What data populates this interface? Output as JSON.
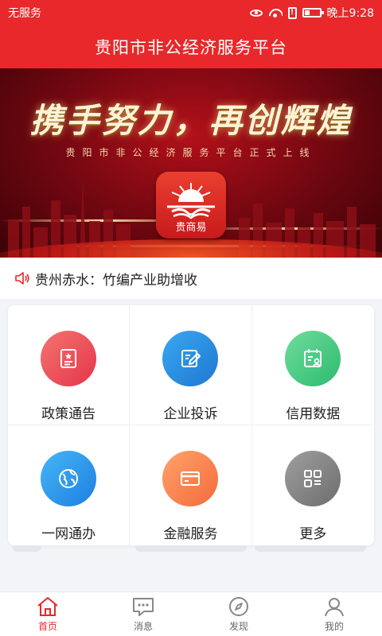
{
  "status_bar": {
    "carrier": "无服务",
    "time": "晚上9:28",
    "icons": [
      "eye-icon",
      "wifi-icon",
      "sim-icon",
      "battery-icon"
    ]
  },
  "header": {
    "title": "贵阳市非公经济服务平台"
  },
  "banner": {
    "headline": "携手努力，再创辉煌",
    "subtitle": "贵阳市非公经济服务平台正式上线",
    "logo_caption": "贵商易"
  },
  "ticker": {
    "icon": "speaker-icon",
    "text": "贵州赤水：竹编产业助增收"
  },
  "services": [
    {
      "label": "政策通告",
      "icon": "policy-document-icon",
      "color_from": "#f3756f",
      "color_to": "#e4344a"
    },
    {
      "label": "企业投诉",
      "icon": "edit-form-icon",
      "color_from": "#3aa7f0",
      "color_to": "#1f78d1"
    },
    {
      "label": "信用数据",
      "icon": "credit-calendar-icon",
      "color_from": "#6fdc9c",
      "color_to": "#2dbb6e"
    },
    {
      "label": "一网通办",
      "icon": "globe-icon",
      "color_from": "#45b6f6",
      "color_to": "#1d7fe0"
    },
    {
      "label": "金融服务",
      "icon": "card-icon",
      "color_from": "#ffa36b",
      "color_to": "#f46a3a"
    },
    {
      "label": "更多",
      "icon": "grid-more-icon",
      "color_from": "#9f9f9f",
      "color_to": "#6d6d6d"
    }
  ],
  "bottom_nav": [
    {
      "label": "首页",
      "icon": "home-icon",
      "active": true
    },
    {
      "label": "消息",
      "icon": "message-icon",
      "active": false
    },
    {
      "label": "发现",
      "icon": "compass-icon",
      "active": false
    },
    {
      "label": "我的",
      "icon": "user-icon",
      "active": false
    }
  ],
  "colors": {
    "brand_red": "#e8282a",
    "text_dark": "#222222",
    "nav_inactive": "#666666"
  }
}
